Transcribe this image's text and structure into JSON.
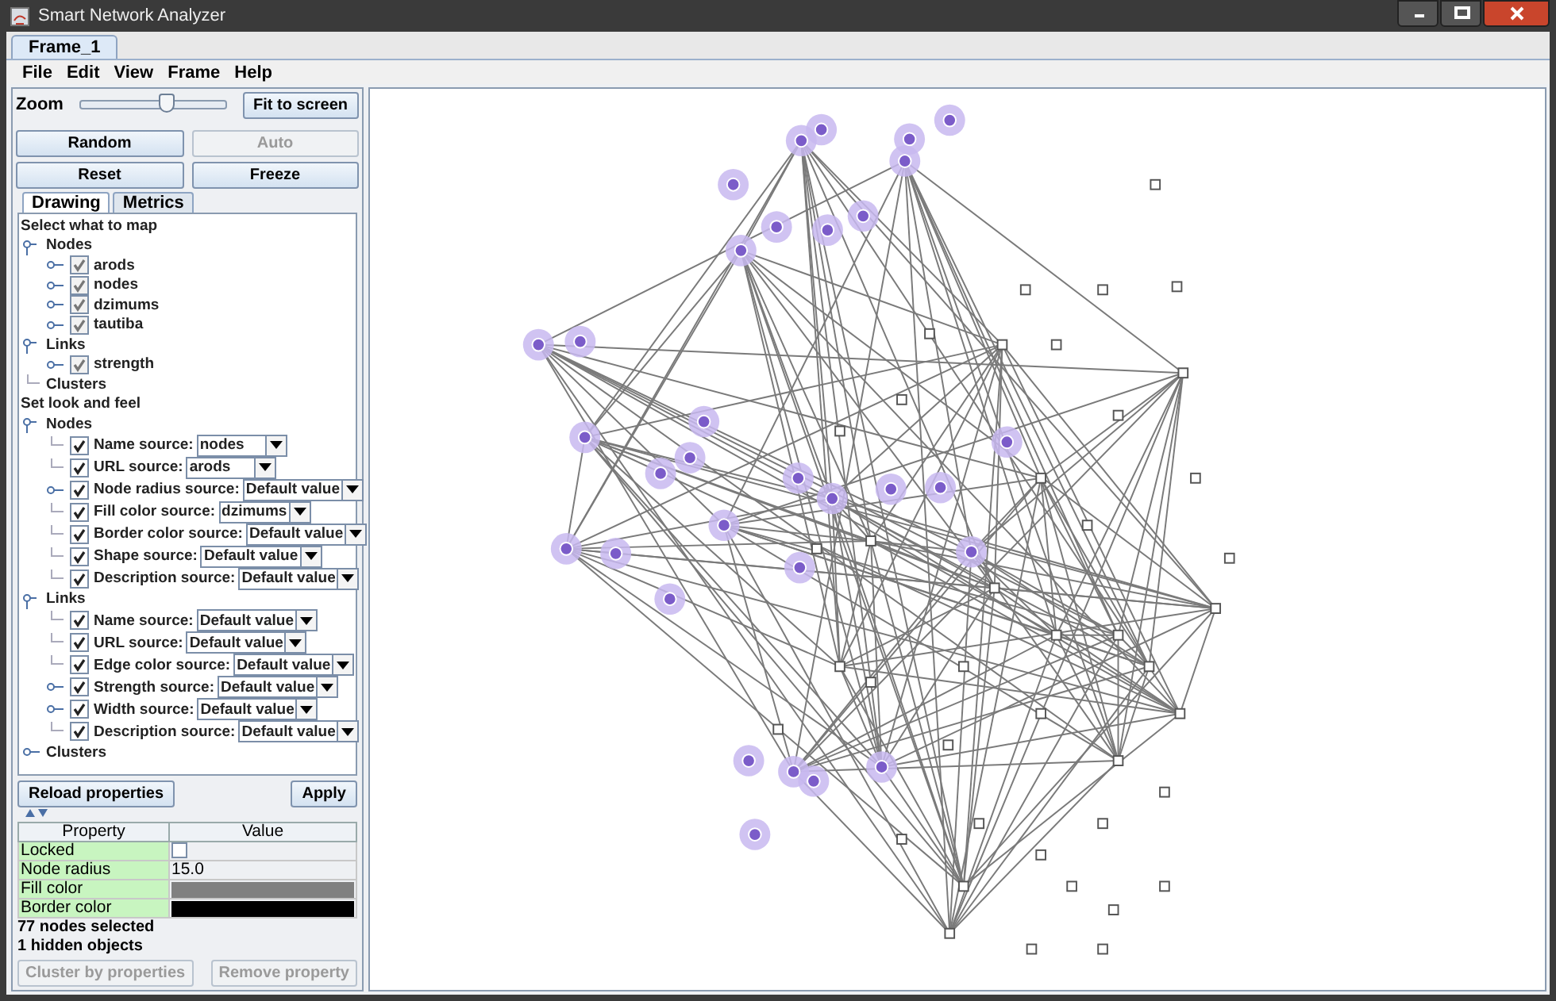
{
  "window": {
    "title": "Smart Network Analyzer"
  },
  "frame_tabs": [
    {
      "label": "Frame_1",
      "selected": true
    }
  ],
  "menu": [
    "File",
    "Edit",
    "View",
    "Frame",
    "Help"
  ],
  "zoom": {
    "label": "Zoom",
    "level": 0.6,
    "button": "Fit to screen"
  },
  "layout_buttons": [
    {
      "label": "Random",
      "disabled": false
    },
    {
      "label": "Auto",
      "disabled": true
    },
    {
      "label": "Reset",
      "disabled": false
    },
    {
      "label": "Freeze",
      "disabled": false
    }
  ],
  "panel_tabs": [
    {
      "label": "Drawing",
      "selected": true
    },
    {
      "label": "Metrics",
      "selected": false
    }
  ],
  "tree": [
    {
      "kind": "heading",
      "label": "Select what to map",
      "children": [
        {
          "kind": "group",
          "label": "Nodes",
          "expanded": true,
          "children": [
            {
              "kind": "check",
              "label": "arods",
              "checked": true,
              "expanded": false
            },
            {
              "kind": "check",
              "label": "nodes",
              "checked": true,
              "expanded": false
            },
            {
              "kind": "check",
              "label": "dzimums",
              "checked": true,
              "expanded": false
            },
            {
              "kind": "check",
              "label": "tautiba",
              "checked": true,
              "expanded": false
            }
          ]
        },
        {
          "kind": "group",
          "label": "Links",
          "expanded": true,
          "children": [
            {
              "kind": "check",
              "label": "strength",
              "checked": true,
              "expanded": false
            }
          ]
        },
        {
          "kind": "group",
          "label": "Clusters"
        }
      ]
    },
    {
      "kind": "heading",
      "label": "Set look and feel",
      "children": [
        {
          "kind": "group",
          "label": "Nodes",
          "expanded": true,
          "children": [
            {
              "kind": "source",
              "label": "Name source:",
              "checked": true,
              "value": "nodes"
            },
            {
              "kind": "source",
              "label": "URL source:",
              "checked": true,
              "value": "arods"
            },
            {
              "kind": "source",
              "label": "Node radius source:",
              "checked": true,
              "value": "Default value",
              "expanded": false
            },
            {
              "kind": "source",
              "label": "Fill color source:",
              "checked": true,
              "value": "dzimums"
            },
            {
              "kind": "source",
              "label": "Border color source:",
              "checked": true,
              "value": "Default value"
            },
            {
              "kind": "source",
              "label": "Shape source:",
              "checked": true,
              "value": "Default value"
            },
            {
              "kind": "source",
              "label": "Description source:",
              "checked": true,
              "value": "Default value"
            }
          ]
        },
        {
          "kind": "group",
          "label": "Links",
          "expanded": true,
          "children": [
            {
              "kind": "source",
              "label": "Name source:",
              "checked": true,
              "value": "Default value"
            },
            {
              "kind": "source",
              "label": "URL source:",
              "checked": true,
              "value": "Default value"
            },
            {
              "kind": "source",
              "label": "Edge color source:",
              "checked": true,
              "value": "Default value"
            },
            {
              "kind": "source",
              "label": "Strength source:",
              "checked": true,
              "value": "Default value",
              "expanded": false
            },
            {
              "kind": "source",
              "label": "Width source:",
              "checked": true,
              "value": "Default value",
              "expanded": false
            },
            {
              "kind": "source",
              "label": "Description source:",
              "checked": true,
              "value": "Default value"
            }
          ]
        },
        {
          "kind": "group",
          "label": "Clusters",
          "expanded": false
        }
      ]
    }
  ],
  "tree_buttons": [
    "Reload properties",
    "Apply"
  ],
  "properties": {
    "columns": [
      "Property",
      "Value"
    ],
    "rows": [
      {
        "name": "Locked",
        "kind": "checkbox",
        "checked": false
      },
      {
        "name": "Node radius",
        "kind": "text",
        "value": "15.0"
      },
      {
        "name": "Fill color",
        "kind": "color",
        "color": "#808080"
      },
      {
        "name": "Border color",
        "kind": "color",
        "color": "#000000"
      }
    ]
  },
  "status": [
    "77 nodes selected",
    "1 hidden objects"
  ],
  "bottom_buttons": [
    {
      "label": "Cluster by properties",
      "disabled": true
    },
    {
      "label": "Remove property",
      "disabled": true
    }
  ]
}
